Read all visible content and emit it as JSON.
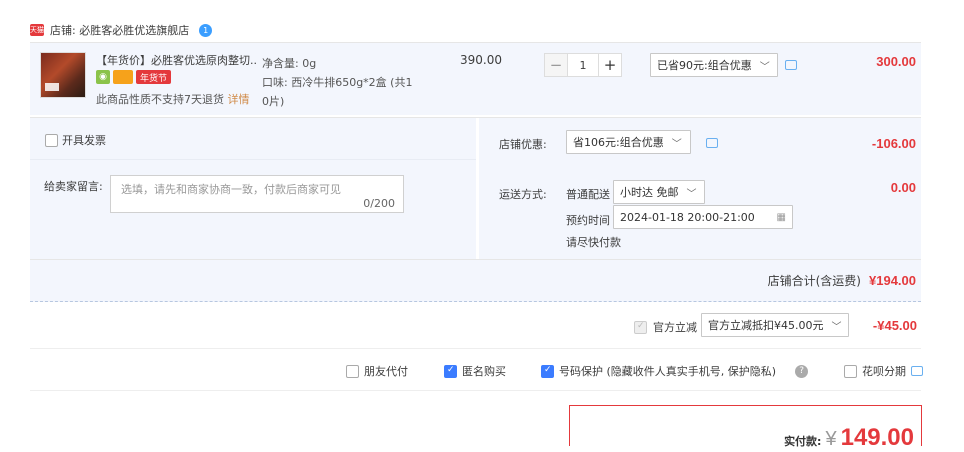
{
  "store": {
    "badge": "天猫",
    "name": "店铺: 必胜客必胜优选旗舰店",
    "ww_badge": "1"
  },
  "item": {
    "title": "【年货价】必胜客优选原肉整切...",
    "badge_tag": "年货节",
    "no_return": "此商品性质不支持7天退货",
    "detail_link": "详情",
    "spec_weight": "净含量: 0g",
    "spec_flavor_1": "口味: 西冷牛排650g*2盒 (共1",
    "spec_flavor_2": "0片)",
    "price": "390.00",
    "quantity": "1",
    "minus": "−",
    "plus": "+",
    "discount_option": "已省90元:组合优惠",
    "subtotal": "300.00"
  },
  "invoice": {
    "label": "开具发票"
  },
  "message": {
    "label": "给卖家留言:",
    "placeholder": "选填，请先和商家协商一致，付款后商家可见",
    "counter": "0/200"
  },
  "store_discount": {
    "label": "店铺优惠:",
    "option": "省106元:组合优惠",
    "amount": "-106.00"
  },
  "delivery": {
    "label": "运送方式:",
    "type": "普通配送",
    "option": "小时达 免邮",
    "reserve_label": "预约时间",
    "reserve_value": "2024-01-18 20:00-21:00",
    "note": "请尽快付款",
    "amount": "0.00"
  },
  "store_total": {
    "label": "店铺合计(含运费)",
    "amount": "¥194.00"
  },
  "official": {
    "label": "官方立减",
    "option": "官方立减抵扣¥45.00元",
    "amount": "-¥45.00"
  },
  "options": {
    "friend_pay": "朋友代付",
    "anonymous": "匿名购买",
    "privacy": "号码保护 (隐藏收件人真实手机号, 保护隐私)",
    "huabei": "花呗分期"
  },
  "final": {
    "label": "实付款:",
    "currency": "¥",
    "amount": "149.00"
  },
  "colors": {
    "accent_red": "#e4393c",
    "panel_bg": "#f3f6fd",
    "check_blue": "#3b7cff"
  }
}
